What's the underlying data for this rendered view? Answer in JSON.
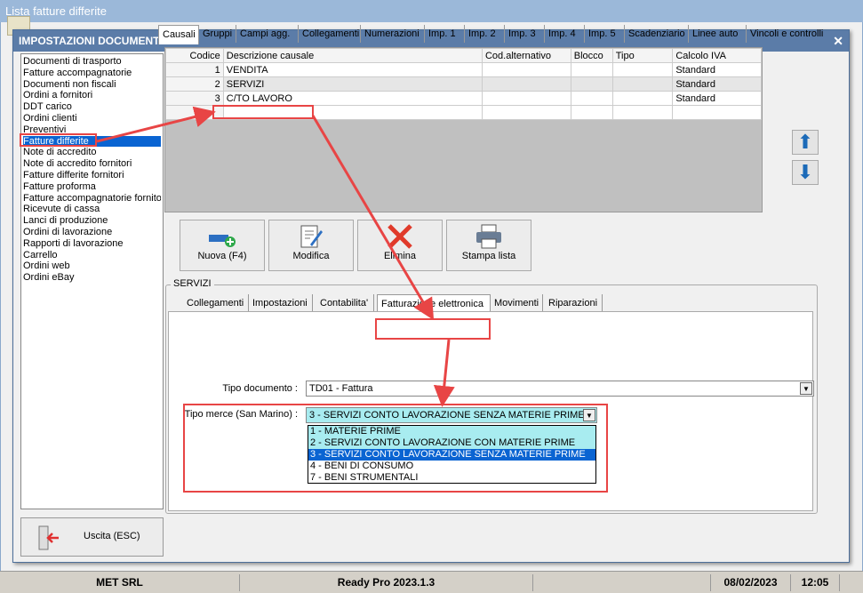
{
  "outer": {
    "title": "Lista fatture differite"
  },
  "status": {
    "company": "MET SRL",
    "app": "Ready Pro 2023.1.3",
    "date": "08/02/2023",
    "time": "12:05"
  },
  "dialog": {
    "title": "IMPOSTAZIONI DOCUMENTI",
    "close": "✕"
  },
  "doclist": [
    "Documenti di trasporto",
    "Fatture accompagnatorie",
    "Documenti non fiscali",
    "Ordini a fornitori",
    "DDT carico",
    "Ordini clienti",
    "Preventivi",
    "Fatture differite",
    "Note di accredito",
    "Note di accredito fornitori",
    "Fatture differite fornitori",
    "Fatture proforma",
    "Fatture accompagnatorie fornito",
    "Ricevute di cassa",
    "Lanci di produzione",
    "Ordini di lavorazione",
    "Rapporti di lavorazione",
    "Carrello",
    "Ordini web",
    "Ordini eBay"
  ],
  "exit": {
    "label": "Uscita (ESC)"
  },
  "tabs": [
    "Causali",
    "Gruppi",
    "Campi agg.",
    "Collegamenti",
    "Numerazioni",
    "Imp. 1",
    "Imp. 2",
    "Imp. 3",
    "Imp. 4",
    "Imp. 5",
    "Scadenziario",
    "Linee auto",
    "Vincoli e controlli"
  ],
  "grid": {
    "headers": [
      "Codice",
      "Descrizione causale",
      "Cod.alternativo",
      "Blocco",
      "Tipo",
      "Calcolo IVA"
    ],
    "rows": [
      [
        "1",
        "VENDITA",
        "",
        "",
        "",
        "Standard"
      ],
      [
        "2",
        "SERVIZI",
        "",
        "",
        "",
        "Standard"
      ],
      [
        "3",
        "C/TO LAVORO",
        "",
        "",
        "",
        "Standard"
      ]
    ]
  },
  "actions": {
    "new": "Nuova (F4)",
    "edit": "Modifica",
    "delete": "Elimina",
    "print": "Stampa lista"
  },
  "group": {
    "title": "SERVIZI"
  },
  "subtabs": [
    "Collegamenti",
    "Impostazioni",
    "Contabilita'",
    "Fatturazione elettronica",
    "Movimenti",
    "Riparazioni"
  ],
  "form": {
    "tipo_doc_label": "Tipo documento :",
    "tipo_doc_value": "TD01 - Fattura",
    "tipo_merce_label": "Tipo merce (San Marino) :",
    "tipo_merce_value": "3 - SERVIZI CONTO LAVORAZIONE SENZA MATERIE PRIME",
    "options": [
      "1 - MATERIE PRIME",
      "2 - SERVIZI CONTO LAVORAZIONE CON MATERIE PRIME",
      "3 - SERVIZI CONTO LAVORAZIONE SENZA MATERIE PRIME",
      "4 - BENI DI CONSUMO",
      "7 - BENI STRUMENTALI"
    ]
  },
  "colors": {
    "annotation": "#e84545",
    "selection": "#0a64d2",
    "highlight": "#a8ecf0"
  }
}
